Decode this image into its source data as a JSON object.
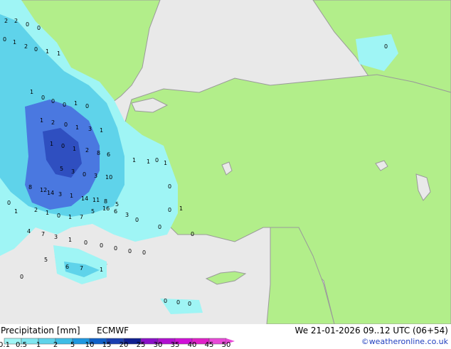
{
  "legend": {
    "title": "Precipitation [mm]",
    "model": "ECMWF",
    "datetime": "We 21-01-2026 09..12 UTC (06+54)",
    "credit": "©weatheronline.co.uk",
    "scale_ticks": [
      "0.1",
      "0.5",
      "1",
      "2",
      "5",
      "10",
      "15",
      "20",
      "25",
      "30",
      "35",
      "40",
      "45",
      "50"
    ],
    "scale_colors": [
      "#9ff5f5",
      "#7fe6f0",
      "#5fd3ea",
      "#3fbde6",
      "#1f98e0",
      "#1060c8",
      "#1a3fb0",
      "#0f1f90",
      "#8a10c8",
      "#b010d0",
      "#d010d8",
      "#e020c8",
      "#e84ad8"
    ]
  },
  "map": {
    "colors": {
      "land": "#b2ee8a",
      "sea": "#e9e9e9",
      "border": "#9a9a9a",
      "precip_light": "#9ff5f5",
      "precip_mid": "#3fbde6",
      "precip_heavy": "#4a78e0"
    },
    "labels": [
      "2",
      "2",
      "0",
      "0",
      "0",
      "1",
      "2",
      "0",
      "1",
      "1",
      "1",
      "0",
      "0",
      "0",
      "1",
      "0",
      "1",
      "2",
      "0",
      "1",
      "3",
      "1",
      "1",
      "0",
      "1",
      "2",
      "8",
      "6",
      "5",
      "3",
      "0",
      "3",
      "10",
      "8",
      "12",
      "14",
      "3",
      "1",
      "14",
      "11",
      "8",
      "5",
      "2",
      "1",
      "0",
      "1",
      "7",
      "5",
      "16",
      "6",
      "3",
      "0",
      "4",
      "7",
      "3",
      "1",
      "0",
      "0",
      "0",
      "0",
      "0",
      "0",
      "0",
      "1",
      "1",
      "0",
      "0",
      "5",
      "6",
      "7",
      "1",
      "0",
      "1",
      "1",
      "1",
      "0",
      "0",
      "0",
      "0",
      "0",
      "0"
    ]
  }
}
